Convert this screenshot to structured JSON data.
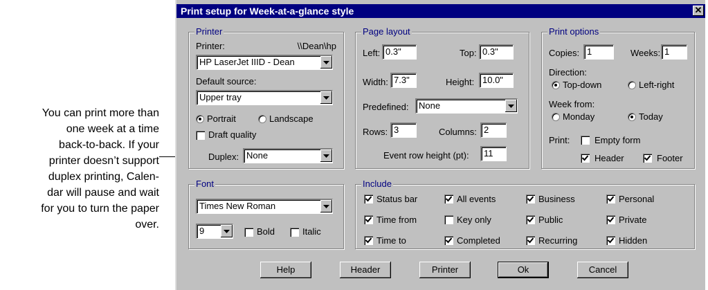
{
  "caption": {
    "lines": [
      "You can print more than",
      "one week at a time",
      "back-to-back. If your",
      "printer doesn’t support",
      "duplex printing, Calen-",
      "dar will pause and wait",
      "for you to turn the paper",
      "over."
    ]
  },
  "dialog": {
    "title": "Print setup for Week-at-a-glance style",
    "close_glyph": "✕"
  },
  "printer": {
    "group_title": "Printer",
    "printer_label": "Printer:",
    "printer_path": "\\\\Dean\\hp",
    "printer_value": "HP LaserJet IIID - Dean",
    "source_label": "Default source:",
    "source_value": "Upper tray",
    "portrait_label": "Portrait",
    "landscape_label": "Landscape",
    "orientation": "Portrait",
    "draft_label": "Draft quality",
    "draft_checked": false,
    "duplex_label": "Duplex:",
    "duplex_value": "None"
  },
  "page_layout": {
    "group_title": "Page layout",
    "left_label": "Left:",
    "left_value": "0.3\"",
    "top_label": "Top:",
    "top_value": "0.3\"",
    "width_label": "Width:",
    "width_value": "7.3\"",
    "height_label": "Height:",
    "height_value": "10.0\"",
    "predefined_label": "Predefined:",
    "predefined_value": "None",
    "rows_label": "Rows:",
    "rows_value": "3",
    "columns_label": "Columns:",
    "columns_value": "2",
    "event_row_label": "Event row height (pt):",
    "event_row_value": "11"
  },
  "print_options": {
    "group_title": "Print options",
    "copies_label": "Copies:",
    "copies_value": "1",
    "weeks_label": "Weeks:",
    "weeks_value": "1",
    "direction_label": "Direction:",
    "top_down_label": "Top-down",
    "left_right_label": "Left-right",
    "direction": "Top-down",
    "week_from_label": "Week from:",
    "monday_label": "Monday",
    "today_label": "Today",
    "week_from": "Today",
    "print_label": "Print:",
    "empty_form_label": "Empty form",
    "empty_form_checked": false,
    "header_label": "Header",
    "header_checked": true,
    "footer_label": "Footer",
    "footer_checked": true
  },
  "font": {
    "group_title": "Font",
    "face_value": "Times New Roman",
    "size_value": "9",
    "bold_label": "Bold",
    "bold_checked": false,
    "italic_label": "Italic",
    "italic_checked": false
  },
  "include": {
    "group_title": "Include",
    "items": [
      {
        "label": "Status bar",
        "checked": true
      },
      {
        "label": "All events",
        "checked": true
      },
      {
        "label": "Business",
        "checked": true
      },
      {
        "label": "Personal",
        "checked": true
      },
      {
        "label": "Time from",
        "checked": true
      },
      {
        "label": "Key only",
        "checked": false
      },
      {
        "label": "Public",
        "checked": true
      },
      {
        "label": "Private",
        "checked": true
      },
      {
        "label": "Time to",
        "checked": true
      },
      {
        "label": "Completed",
        "checked": true
      },
      {
        "label": "Recurring",
        "checked": true
      },
      {
        "label": "Hidden",
        "checked": true
      }
    ]
  },
  "buttons": {
    "help": "Help",
    "header": "Header",
    "printer": "Printer",
    "ok": "Ok",
    "cancel": "Cancel"
  },
  "icons": {
    "checkmark": "check-icon",
    "dropdown": "chevron-down-icon",
    "radio_dot": "radio-dot-icon"
  },
  "colors": {
    "title_bar": "#000080",
    "dialog_face": "#c0c0c0",
    "group_title": "#000080"
  }
}
